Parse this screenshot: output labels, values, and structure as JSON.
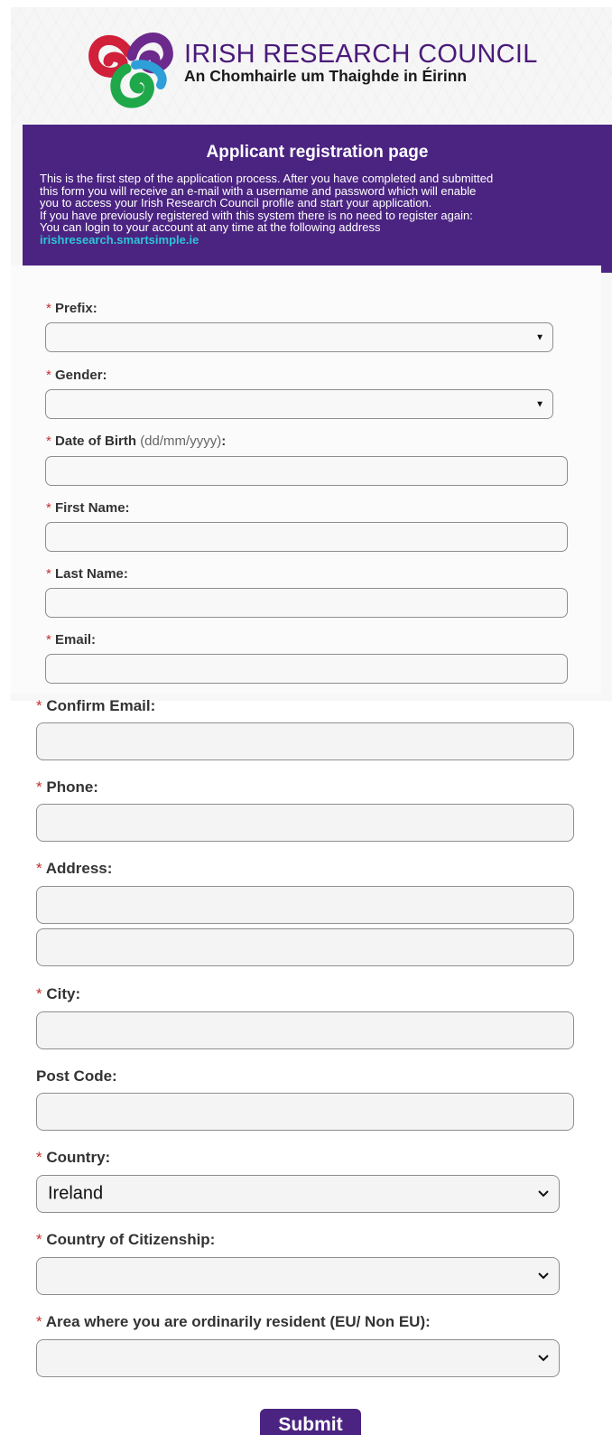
{
  "logo": {
    "title": "IRISH RESEARCH COUNCIL",
    "subtitle": "An Chomhairle um Thaighde in Éirinn"
  },
  "banner": {
    "title": "Applicant registration page",
    "line1": "This is the first step of the application process. After you have completed and submitted",
    "line2": "this form you will receive an e-mail with a username and password which will enable",
    "line3": "you to access your Irish Research Council profile and start your application.",
    "line4": "If you have previously registered with this system there is no need to register again:",
    "line5": "You can login to your account at any time at the following address",
    "link": "irishresearch.smartsimple.ie"
  },
  "required_marker": "*",
  "fields": {
    "prefix": {
      "label": "Prefix:",
      "value": ""
    },
    "gender": {
      "label": "Gender:",
      "value": ""
    },
    "dob": {
      "label": "Date of Birth",
      "hint": "(dd/mm/yyyy)",
      "colon": ":"
    },
    "first_name": {
      "label": "First Name:"
    },
    "last_name": {
      "label": "Last Name:"
    },
    "email": {
      "label": "Email:"
    },
    "confirm_email": {
      "label": "Confirm Email:"
    },
    "phone": {
      "label": "Phone:"
    },
    "address": {
      "label": "Address:"
    },
    "city": {
      "label": "City:"
    },
    "post_code": {
      "label": "Post Code:"
    },
    "country": {
      "label": "Country:",
      "value": "Ireland"
    },
    "citizenship": {
      "label": "Country of Citizenship:",
      "value": ""
    },
    "residence": {
      "label": "Area where you are ordinarily resident (EU/ Non EU):",
      "value": ""
    }
  },
  "submit_label": "Submit",
  "colors": {
    "brand_purple": "#4b2482",
    "link_cyan": "#2ec4d6",
    "required_red": "#c0322f"
  }
}
